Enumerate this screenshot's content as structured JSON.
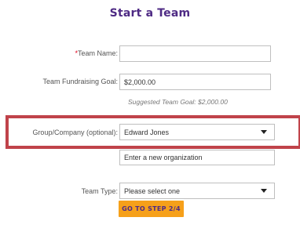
{
  "page": {
    "title": "Start a Team"
  },
  "form": {
    "team_name": {
      "label": "Team Name:",
      "required_mark": "*",
      "value": ""
    },
    "fundraising_goal": {
      "label": "Team Fundraising Goal:",
      "value": "$2,000.00",
      "hint": "Suggested Team Goal: $2,000.00"
    },
    "group_company": {
      "label": "Group/Company (optional):",
      "selected": "Edward Jones",
      "new_org_value": "Enter a new organization"
    },
    "team_type": {
      "label": "Team Type:",
      "selected": "Please select one"
    },
    "submit_label": "GO TO STEP 2/4"
  },
  "colors": {
    "title": "#4e2a84",
    "button": "#f6a01a",
    "highlight": "#c0434a",
    "required": "#e0001b"
  }
}
